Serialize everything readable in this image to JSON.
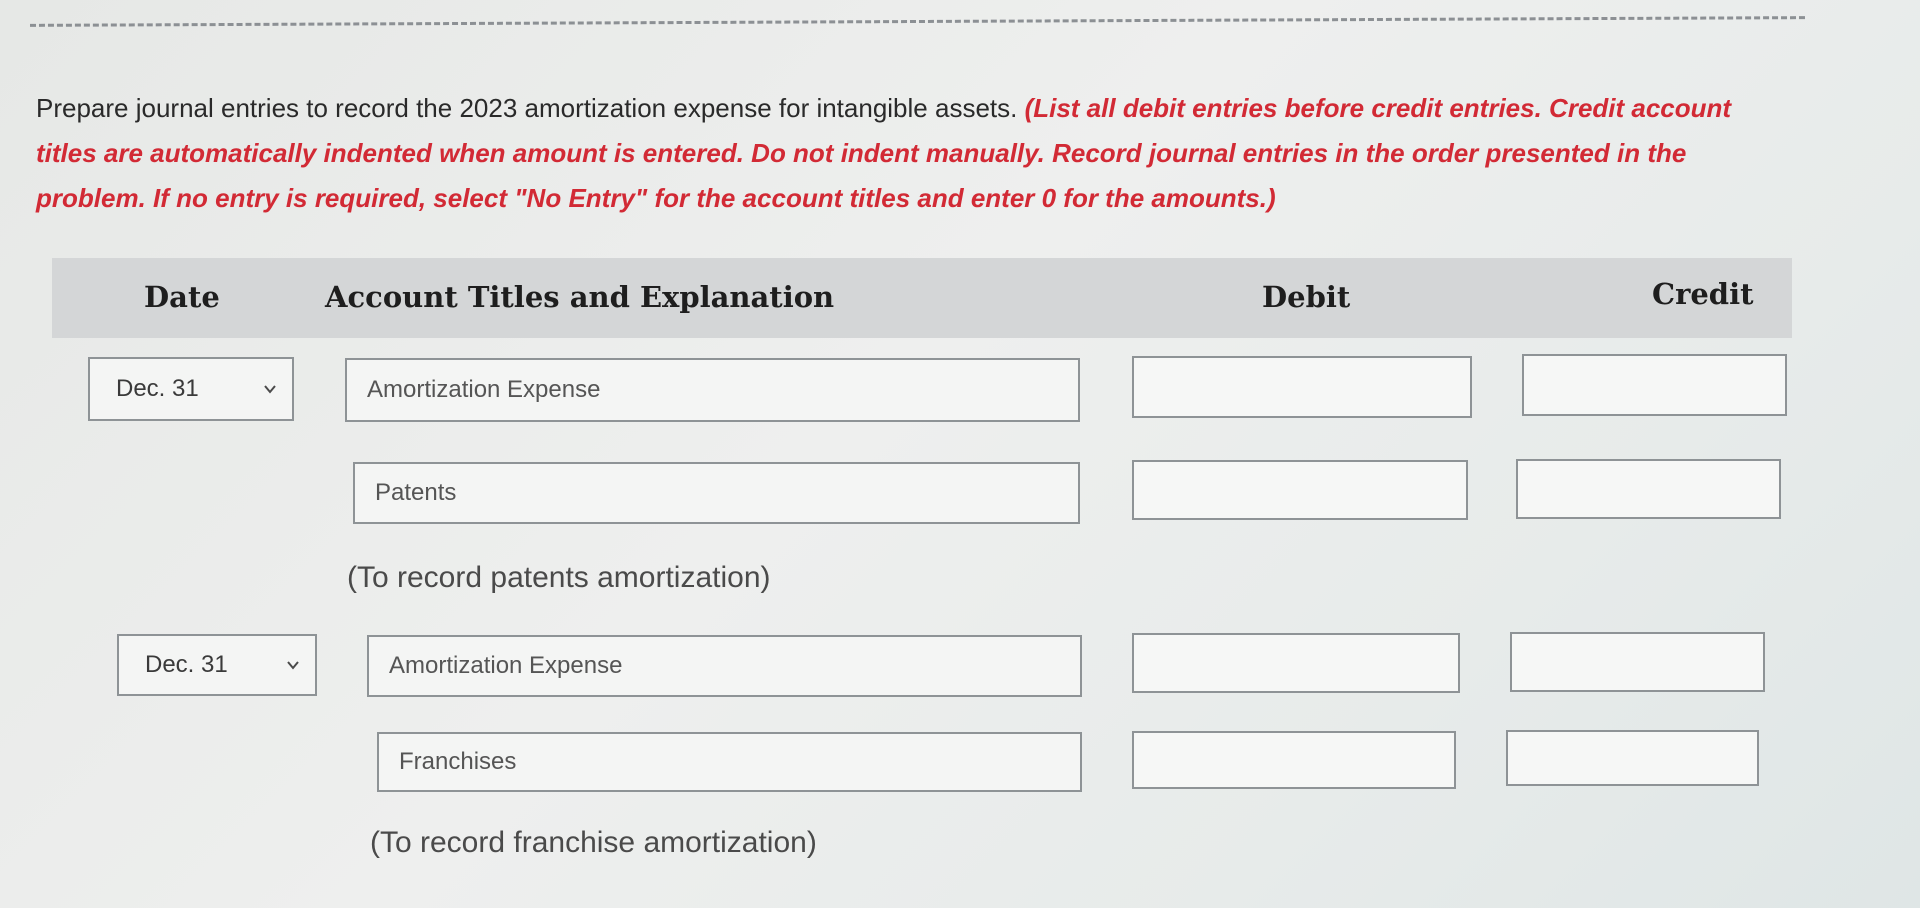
{
  "instructions": {
    "text": "Prepare journal entries to record the 2023 amortization expense for intangible assets. ",
    "note": "(List all debit entries before credit entries. Credit account titles are automatically indented when amount is entered. Do not indent manually. Record journal entries in the order presented in the problem. If no entry is required, select \"No Entry\" for the account titles and enter 0 for the amounts.)"
  },
  "table": {
    "headers": {
      "date": "Date",
      "account": "Account Titles and Explanation",
      "debit": "Debit",
      "credit": "Credit"
    }
  },
  "entries": [
    {
      "date": "Dec. 31",
      "lines": [
        {
          "account": "Amortization Expense",
          "debit": "",
          "credit": ""
        },
        {
          "account": "Patents",
          "debit": "",
          "credit": ""
        }
      ],
      "memo": "(To record patents amortization)"
    },
    {
      "date": "Dec. 31",
      "lines": [
        {
          "account": "Amortization Expense",
          "debit": "",
          "credit": ""
        },
        {
          "account": "Franchises",
          "debit": "",
          "credit": ""
        }
      ],
      "memo": "(To record franchise amortization)"
    }
  ],
  "icons": {
    "dropdown": "chevron-down-icon"
  }
}
